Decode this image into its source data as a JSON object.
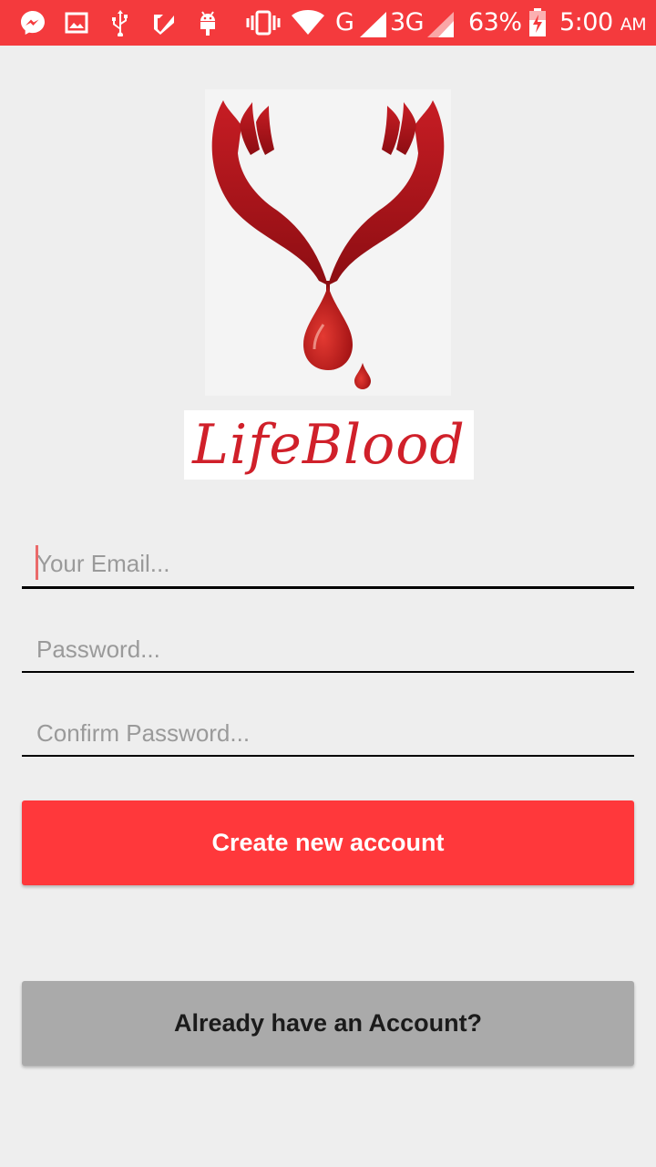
{
  "status_bar": {
    "icons": [
      "messenger-icon",
      "gallery-icon",
      "usb-icon",
      "checkmark-app-icon",
      "android-debug-icon",
      "vibrate-icon",
      "wifi-icon",
      "signal-icon",
      "signal-3g-icon",
      "battery-charging-icon"
    ],
    "network_g": "G",
    "network_3g": "3G",
    "battery": "63%",
    "time": "5:00",
    "ampm": "AM",
    "color": "#f43a3d"
  },
  "logo": {
    "wordmark": "LifeBlood",
    "image": "hands-blood-drop-logo"
  },
  "form": {
    "email_placeholder": "Your Email...",
    "password_placeholder": "Password...",
    "confirm_placeholder": "Confirm Password..."
  },
  "actions": {
    "create_label": "Create new account",
    "login_label": "Already have an Account?",
    "create_color": "#ff383b",
    "login_color": "#aaaaaa"
  }
}
